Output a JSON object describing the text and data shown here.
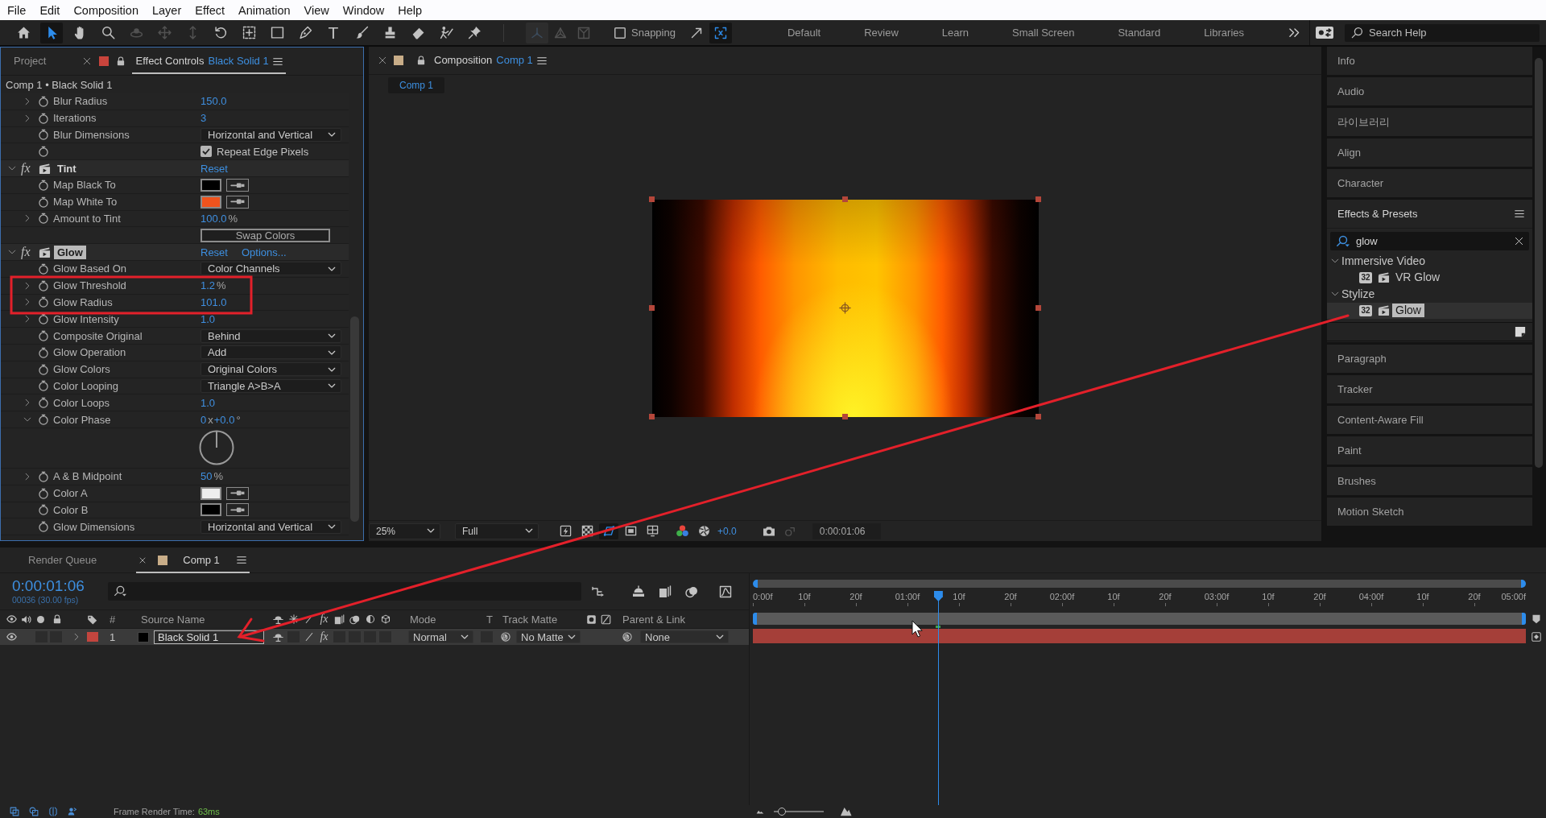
{
  "menu_bar": {
    "items": [
      "File",
      "Edit",
      "Composition",
      "Layer",
      "Effect",
      "Animation",
      "View",
      "Window",
      "Help"
    ]
  },
  "toolbar": {
    "tools": [
      {
        "kind": "home",
        "selected": false,
        "disabled": false
      },
      {
        "kind": "selection",
        "selected": true,
        "disabled": false
      },
      {
        "kind": "hand",
        "selected": false,
        "disabled": false
      },
      {
        "kind": "zoom",
        "selected": false,
        "disabled": false
      },
      {
        "kind": "orbit",
        "selected": false,
        "disabled": true
      },
      {
        "kind": "pan",
        "selected": false,
        "disabled": true
      },
      {
        "kind": "dolly",
        "selected": false,
        "disabled": true
      },
      {
        "kind": "rotation",
        "selected": false,
        "disabled": false
      },
      {
        "kind": "pan-behind",
        "selected": false,
        "disabled": false
      },
      {
        "kind": "rectangle",
        "selected": false,
        "disabled": false
      },
      {
        "kind": "pen",
        "selected": false,
        "disabled": false
      },
      {
        "kind": "type",
        "glyph": "T",
        "selected": false,
        "disabled": false
      },
      {
        "kind": "brush",
        "selected": false,
        "disabled": false
      },
      {
        "kind": "clone-stamp",
        "selected": false,
        "disabled": false
      },
      {
        "kind": "eraser",
        "selected": false,
        "disabled": false
      },
      {
        "kind": "roto-brush",
        "selected": false,
        "disabled": false
      },
      {
        "kind": "puppet",
        "selected": false,
        "disabled": false
      }
    ],
    "axis_modes": [
      {
        "kind": "local",
        "selected": true,
        "disabled": true
      },
      {
        "kind": "world",
        "selected": false,
        "disabled": true
      },
      {
        "kind": "view",
        "selected": false,
        "disabled": true
      }
    ],
    "snapping": {
      "label": "Snapping",
      "checked": false
    },
    "snap_options": [
      {
        "kind": "edges",
        "on": false
      },
      {
        "kind": "features",
        "on": true
      }
    ],
    "workspaces": [
      {
        "label": "Default",
        "selected": false
      },
      {
        "label": "Review",
        "selected": false
      },
      {
        "label": "Learn",
        "selected": false
      },
      {
        "label": "Small Screen",
        "selected": false
      },
      {
        "label": "Standard",
        "selected": false
      },
      {
        "label": "Libraries",
        "selected": false
      }
    ],
    "search_help": {
      "placeholder": "Search Help"
    }
  },
  "effect_controls": {
    "tabs": [
      {
        "label": "Project",
        "selected": false
      },
      {
        "label": "Effect Controls",
        "target": "Black Solid 1",
        "color": "#c8443c",
        "selected": true
      }
    ],
    "breadcrumb": "Comp 1 • Black Solid 1",
    "rows": [
      {
        "kind": "number",
        "label": "Blur Radius",
        "value": "150.0",
        "expanded": false
      },
      {
        "kind": "number",
        "label": "Iterations",
        "value": "3",
        "expanded": false
      },
      {
        "kind": "dropdown",
        "label": "Blur Dimensions",
        "value": "Horizontal and Vertical"
      },
      {
        "kind": "checkbox",
        "text": "Repeat Edge Pixels",
        "checked": true
      },
      {
        "kind": "effect",
        "name": "Tint",
        "switch": "fx",
        "expanded": true,
        "selected": false,
        "actions": [
          "Reset"
        ]
      },
      {
        "kind": "color",
        "label": "Map Black To",
        "color": "#000000"
      },
      {
        "kind": "color",
        "label": "Map White To",
        "color": "#ef531d"
      },
      {
        "kind": "number",
        "label": "Amount to Tint",
        "value": "100.0",
        "unit": "%",
        "expanded": false
      },
      {
        "kind": "button",
        "text": "Swap Colors"
      },
      {
        "kind": "effect",
        "name": "Glow",
        "switch": "fx",
        "expanded": true,
        "selected": true,
        "actions": [
          "Reset",
          "Options..."
        ]
      },
      {
        "kind": "dropdown",
        "label": "Glow Based On",
        "value": "Color Channels"
      },
      {
        "kind": "number",
        "label": "Glow Threshold",
        "value": "1.2",
        "unit": "%",
        "expanded": false
      },
      {
        "kind": "number",
        "label": "Glow Radius",
        "value": "101.0",
        "expanded": false
      },
      {
        "kind": "number",
        "label": "Glow Intensity",
        "value": "1.0",
        "expanded": false
      },
      {
        "kind": "dropdown",
        "label": "Composite Original",
        "value": "Behind"
      },
      {
        "kind": "dropdown",
        "label": "Glow Operation",
        "value": "Add"
      },
      {
        "kind": "dropdown",
        "label": "Glow Colors",
        "value": "Original Colors"
      },
      {
        "kind": "dropdown",
        "label": "Color Looping",
        "value": "Triangle A>B>A"
      },
      {
        "kind": "number",
        "label": "Color Loops",
        "value": "1.0",
        "expanded": false
      },
      {
        "kind": "angle",
        "label": "Color Phase",
        "revolutions": "0",
        "revolutions_unit": "x",
        "degrees": "+0.0",
        "degrees_unit": "°",
        "expanded": true
      },
      {
        "kind": "dial"
      },
      {
        "kind": "number",
        "label": "A & B Midpoint",
        "value": "50",
        "unit": "%",
        "expanded": false
      },
      {
        "kind": "color",
        "label": "Color A",
        "color": "#eeeeee"
      },
      {
        "kind": "color",
        "label": "Color B",
        "color": "#000000"
      },
      {
        "kind": "dropdown",
        "label": "Glow Dimensions",
        "value": "Horizontal and Vertical"
      }
    ]
  },
  "composition": {
    "tab": {
      "label": "Composition",
      "target": "Comp 1",
      "color": "#c8ad88"
    },
    "viewer_tabs": [
      {
        "label": "Comp 1",
        "selected": true
      }
    ],
    "viewer": {
      "zoom": "25%",
      "resolution": "Full",
      "toggles": [
        {
          "kind": "fast-previews",
          "on": false
        },
        {
          "kind": "transparency-grid",
          "on": false
        },
        {
          "kind": "mask-visibility",
          "on": true
        },
        {
          "kind": "region-of-interest",
          "on": false
        },
        {
          "kind": "grid-guides",
          "on": false
        }
      ],
      "exposure": "+0.0",
      "timecode": "0:00:01:06"
    }
  },
  "side_panels": {
    "above": [
      "Info",
      "Audio",
      "라이브러리",
      "Align",
      "Character"
    ],
    "effects_presets": {
      "title": "Effects & Presets",
      "search": {
        "value": "glow"
      },
      "tree": [
        {
          "label": "Immersive Video",
          "expanded": true,
          "children": [
            {
              "label": "VR Glow",
              "bit_depth": "32",
              "selected": false
            }
          ]
        },
        {
          "label": "Stylize",
          "expanded": true,
          "children": [
            {
              "label": "Glow",
              "bit_depth": "32",
              "selected": true
            }
          ]
        }
      ]
    },
    "below": [
      "Paragraph",
      "Tracker",
      "Content-Aware Fill",
      "Paint",
      "Brushes",
      "Motion Sketch"
    ]
  },
  "timeline": {
    "tabs": [
      {
        "label": "Render Queue",
        "selected": false
      },
      {
        "label": "Comp 1",
        "color": "#c8ad88",
        "selected": true
      }
    ],
    "timecode": "0:00:01:06",
    "frame_info": "00036 (30.00 fps)",
    "columns": {
      "number": "#",
      "source_name": "Source Name",
      "effects_switch": "fx",
      "mode": "Mode",
      "preserve_transparency": "T",
      "track_matte": "Track Matte",
      "parent": "Parent & Link"
    },
    "layers": [
      {
        "number": "1",
        "color": "#c2453e",
        "source": {
          "color": "#000000"
        },
        "name": "Black Solid 1",
        "effects": "fx",
        "mode": "Normal",
        "track_matte": "No Matte",
        "parent": "None",
        "visible": true,
        "selected": true,
        "expanded": false
      }
    ],
    "ruler": [
      "0:00f",
      "10f",
      "20f",
      "01:00f",
      "10f",
      "20f",
      "02:00f",
      "10f",
      "20f",
      "03:00f",
      "10f",
      "20f",
      "04:00f",
      "10f",
      "20f",
      "05:00f"
    ],
    "playhead": {
      "level": 0.24
    }
  },
  "status_bar": {
    "label": "Frame Render Time:",
    "value": "63ms",
    "zoom_slider": {
      "level": 0.16
    }
  }
}
